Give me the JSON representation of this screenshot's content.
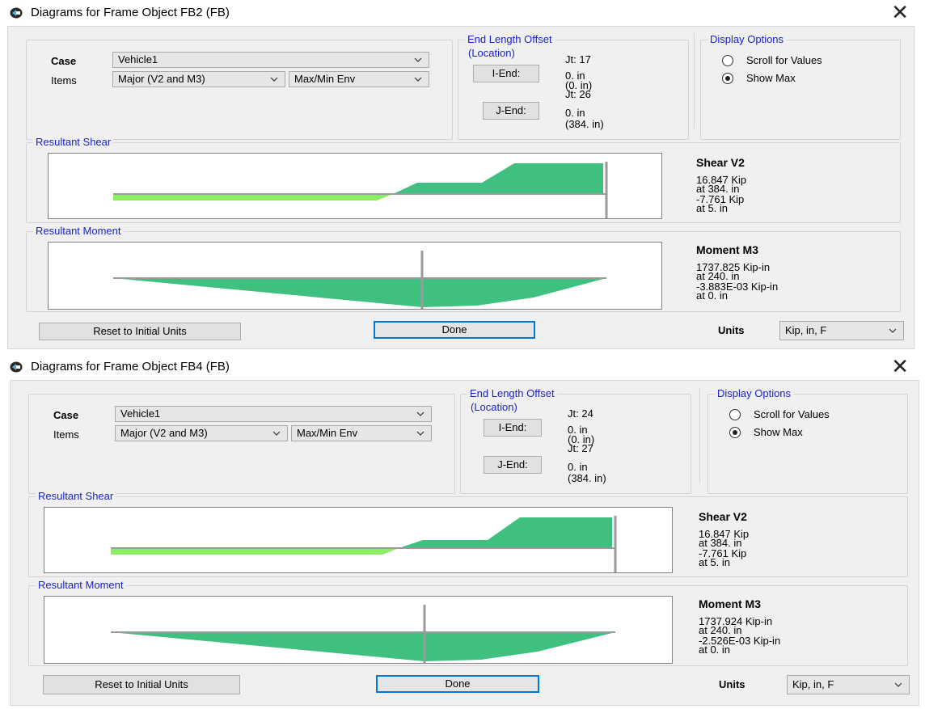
{
  "colors": {
    "legend": "#1a23c8",
    "shear_positive": "#3fc080",
    "shear_negative": "#88f060",
    "moment_fill": "#3fc080",
    "focus_border": "#0078d7"
  },
  "windows": [
    {
      "title": "Diagrams for Frame Object FB2  (FB)",
      "case_label": "Case",
      "case_value": "Vehicle1",
      "items_label": "Items",
      "items_value": "Major (V2 and M3)",
      "env_value": "Max/Min Env",
      "end_offset": {
        "legend": "End Length Offset",
        "location_label": "(Location)",
        "i_jt": "Jt:  17",
        "i_button": "I-End:",
        "i_value": "0. in",
        "i_location": "(0. in)",
        "j_jt": "Jt:  26",
        "j_button": "J-End:",
        "j_value": "0. in",
        "j_location": "(384. in)"
      },
      "display_options": {
        "legend": "Display Options",
        "option_scroll": "Scroll for Values",
        "option_show_max": "Show Max",
        "selected": "Show Max"
      },
      "shear": {
        "legend": "Resultant Shear",
        "heading": "Shear V2",
        "max_value": "16.847 Kip",
        "max_at": "at 384. in",
        "min_value": "-7.761 Kip",
        "min_at": "at 5. in"
      },
      "moment": {
        "legend": "Resultant Moment",
        "heading": "Moment M3",
        "max_value": "1737.825 Kip-in",
        "max_at": "at 240. in",
        "min_value": "-3.883E-03 Kip-in",
        "min_at": "at 0. in"
      },
      "reset_label": "Reset to Initial Units",
      "done_label": "Done",
      "units_label": "Units",
      "units_value": "Kip, in, F"
    },
    {
      "title": "Diagrams for Frame Object FB4  (FB)",
      "case_label": "Case",
      "case_value": "Vehicle1",
      "items_label": "Items",
      "items_value": "Major (V2 and M3)",
      "env_value": "Max/Min Env",
      "end_offset": {
        "legend": "End Length Offset",
        "location_label": "(Location)",
        "i_jt": "Jt:  24",
        "i_button": "I-End:",
        "i_value": "0. in",
        "i_location": "(0. in)",
        "j_jt": "Jt:  27",
        "j_button": "J-End:",
        "j_value": "0. in",
        "j_location": "(384. in)"
      },
      "display_options": {
        "legend": "Display Options",
        "option_scroll": "Scroll for Values",
        "option_show_max": "Show Max",
        "selected": "Show Max"
      },
      "shear": {
        "legend": "Resultant Shear",
        "heading": "Shear V2",
        "max_value": "16.847 Kip",
        "max_at": "at 384. in",
        "min_value": "-7.761 Kip",
        "min_at": "at 5. in"
      },
      "moment": {
        "legend": "Resultant Moment",
        "heading": "Moment M3",
        "max_value": "1737.924 Kip-in",
        "max_at": "at 240. in",
        "min_value": "-2.526E-03 Kip-in",
        "min_at": "at 0. in"
      },
      "reset_label": "Reset to Initial Units",
      "done_label": "Done",
      "units_label": "Units",
      "units_value": "Kip, in, F"
    }
  ]
}
